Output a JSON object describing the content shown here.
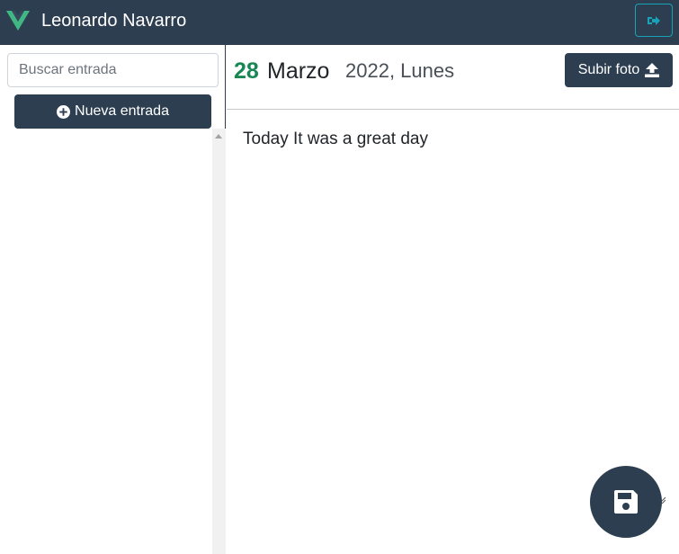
{
  "navbar": {
    "user_name": "Leonardo Navarro",
    "logo_icon": "vue-logo-icon",
    "logout_icon": "sign-out-icon"
  },
  "sidebar": {
    "search": {
      "placeholder": "Buscar entrada",
      "value": ""
    },
    "new_entry": {
      "label": "Nueva entrada",
      "icon": "plus-circle-icon"
    },
    "entries": []
  },
  "entry": {
    "day": "28",
    "month": "Marzo",
    "year_weekday": "2022, Lunes",
    "upload_label": "Subir foto",
    "upload_icon": "upload-icon",
    "text": "Today It was a great day",
    "save_icon": "save-icon"
  },
  "colors": {
    "primary": "#2c3e50",
    "day_accent": "#198754",
    "logout_border": "#17a2b8",
    "logo_green": "#41b883",
    "logo_dark": "#35495e"
  }
}
